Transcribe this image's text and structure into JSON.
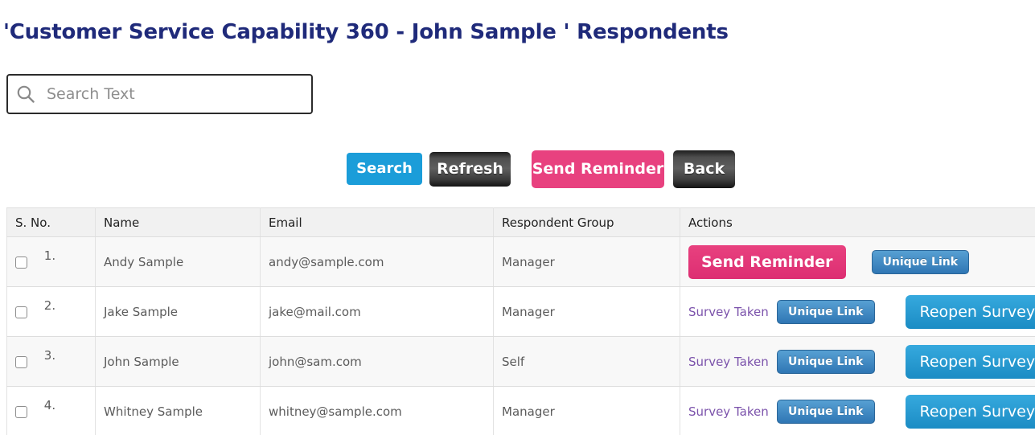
{
  "page": {
    "title": "'Customer Service Capability 360 - John Sample ' Respondents",
    "title_color": "#1f2a7a"
  },
  "toolbar": {
    "search": {
      "icon": "search-icon",
      "value": "",
      "placeholder": "Search Text"
    },
    "buttons": {
      "search": "Search",
      "refresh": "Refresh",
      "send_reminder": "Send Reminder",
      "back": "Back"
    },
    "colors": {
      "search_blue": "#1b9dd9",
      "pink": "#e8417f",
      "dark": "#4e4e4e"
    }
  },
  "table": {
    "columns": [
      "S. No.",
      "Name",
      "Email",
      "Respondent Group",
      "Actions"
    ],
    "rows": [
      {
        "sno": "1.",
        "name": "Andy Sample",
        "email": "andy@sample.com",
        "group": "Manager",
        "actions": {
          "send_reminder": "Send Reminder",
          "unique_link": "Unique Link"
        }
      },
      {
        "sno": "2.",
        "name": "Jake Sample",
        "email": "jake@mail.com",
        "group": "Manager",
        "actions": {
          "survey_taken": "Survey Taken",
          "unique_link": "Unique Link",
          "reopen_survey": "Reopen Survey"
        }
      },
      {
        "sno": "3.",
        "name": "John Sample",
        "email": "john@sam.com",
        "group": "Self",
        "actions": {
          "survey_taken": "Survey Taken",
          "unique_link": "Unique Link",
          "reopen_survey": "Reopen Survey"
        }
      },
      {
        "sno": "4.",
        "name": "Whitney Sample",
        "email": "whitney@sample.com",
        "group": "Manager",
        "actions": {
          "survey_taken": "Survey Taken",
          "unique_link": "Unique Link",
          "reopen_survey": "Reopen Survey"
        }
      }
    ]
  }
}
